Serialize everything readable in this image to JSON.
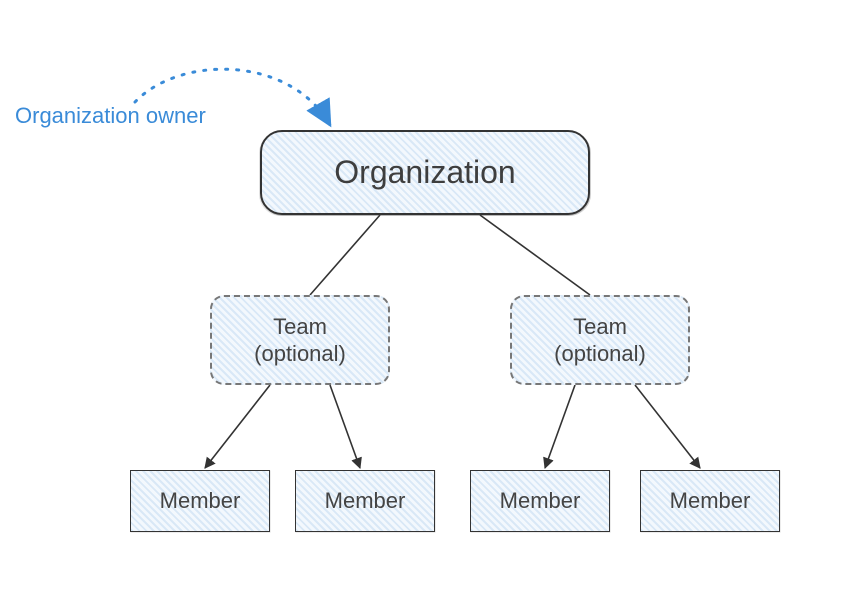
{
  "annotation": {
    "owner_label": "Organization owner"
  },
  "nodes": {
    "organization": {
      "label": "Organization"
    },
    "team_left": {
      "label": "Team\n(optional)"
    },
    "team_right": {
      "label": "Team\n(optional)"
    },
    "member_1": {
      "label": "Member"
    },
    "member_2": {
      "label": "Member"
    },
    "member_3": {
      "label": "Member"
    },
    "member_4": {
      "label": "Member"
    }
  },
  "colors": {
    "annotation": "#3a8bd8",
    "node_fill_tint": "#e1edf8",
    "node_border": "#333333",
    "team_border": "#777777"
  },
  "diagram": {
    "type": "hierarchy",
    "description": "Organization ownership hierarchy: an Organization (pointed to by an 'Organization owner' annotation) branches into two optional Teams, each of which branches into two Members.",
    "edges": [
      {
        "from": "annotation.owner_label",
        "to": "organization",
        "style": "dotted-arrow"
      },
      {
        "from": "organization",
        "to": "team_left",
        "style": "solid-line"
      },
      {
        "from": "organization",
        "to": "team_right",
        "style": "solid-line"
      },
      {
        "from": "team_left",
        "to": "member_1",
        "style": "solid-arrow"
      },
      {
        "from": "team_left",
        "to": "member_2",
        "style": "solid-arrow"
      },
      {
        "from": "team_right",
        "to": "member_3",
        "style": "solid-arrow"
      },
      {
        "from": "team_right",
        "to": "member_4",
        "style": "solid-arrow"
      }
    ]
  }
}
